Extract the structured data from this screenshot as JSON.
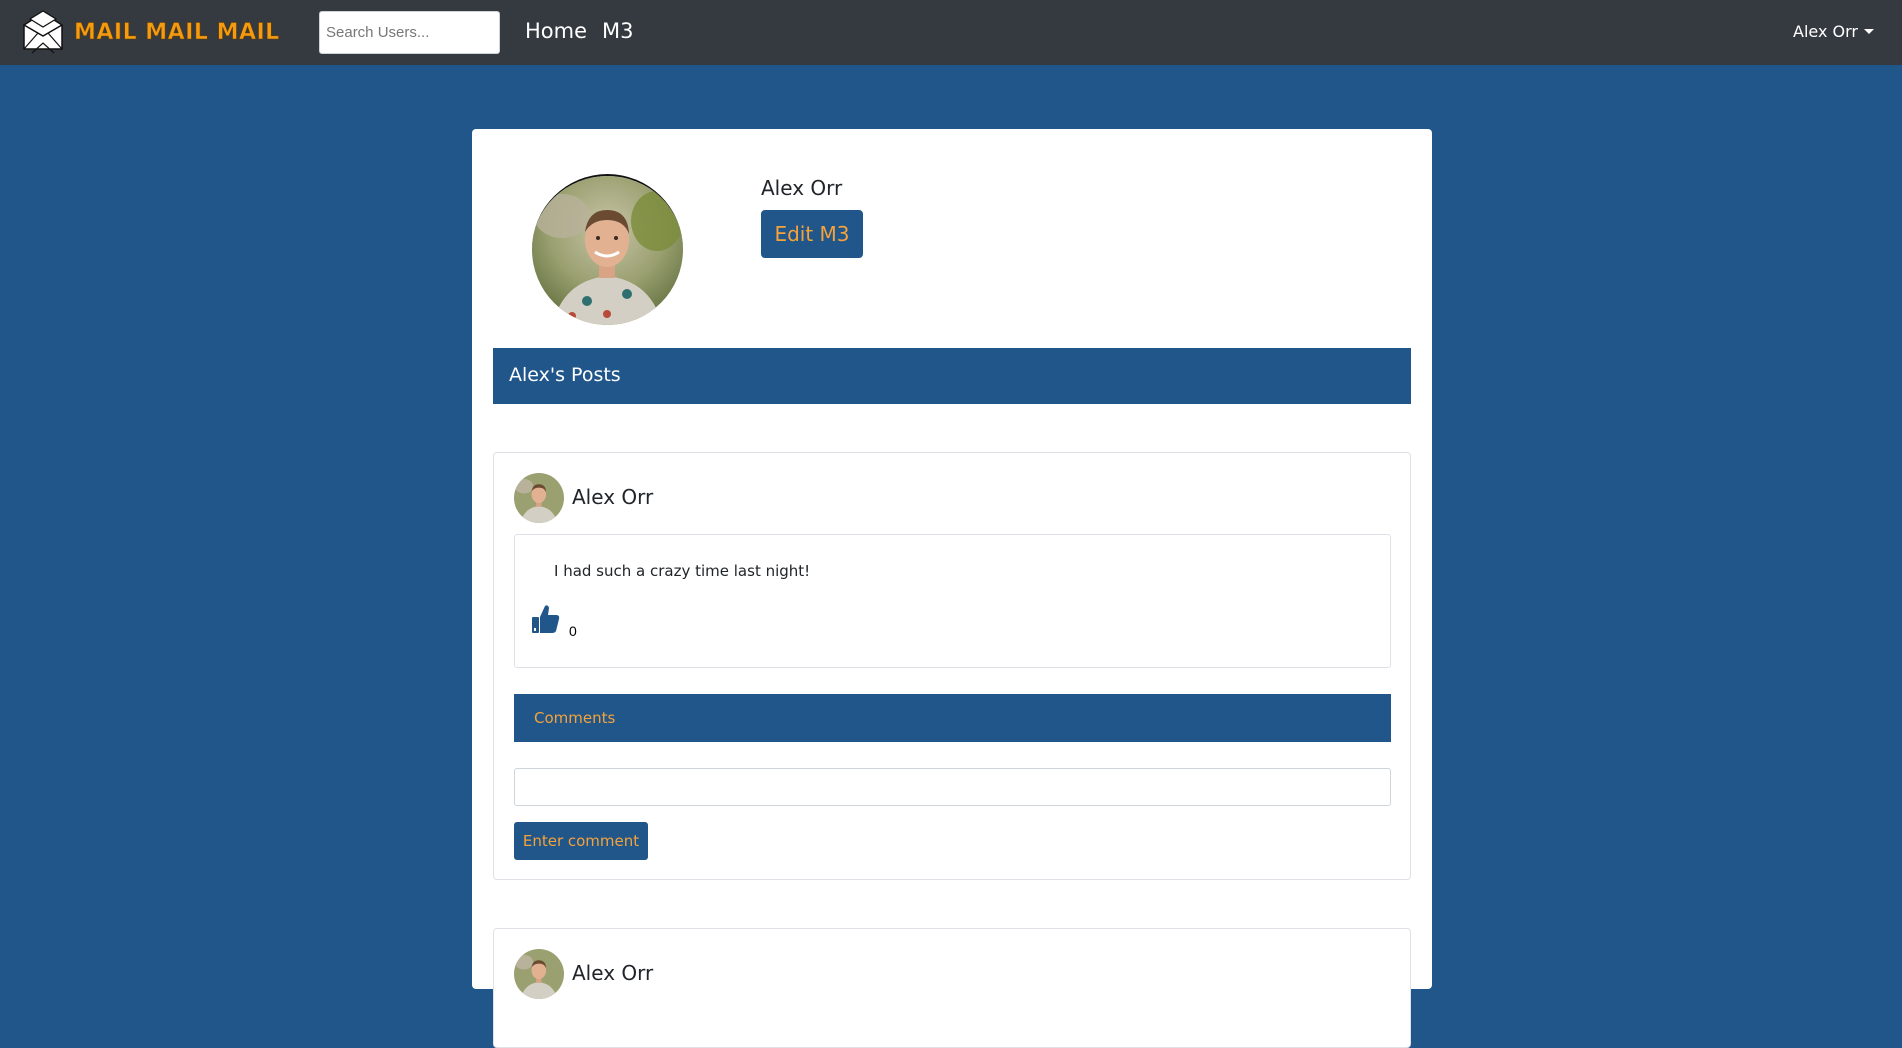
{
  "navbar": {
    "brand_text": "MAIL MAIL MAIL",
    "brand_icon": "envelope-logo-icon",
    "search_placeholder": "Search Users...",
    "links": [
      "Home",
      "M3"
    ],
    "user_menu_label": "Alex Orr"
  },
  "profile": {
    "name": "Alex Orr",
    "edit_button_label": "Edit M3"
  },
  "posts_section": {
    "header": "Alex's Posts"
  },
  "posts": [
    {
      "author": "Alex Orr",
      "text": "I had such a crazy time last night!",
      "like_count": "0",
      "comments_header": "Comments",
      "comment_input_value": "",
      "comment_button_label": "Enter comment"
    },
    {
      "author": "Alex Orr"
    }
  ],
  "colors": {
    "page_background": "#20568a",
    "navbar": "#343a40",
    "accent_orange": "#f5a23a",
    "brand_orange": "#f39c12"
  }
}
